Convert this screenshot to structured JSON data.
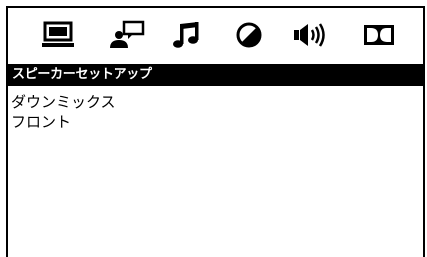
{
  "tabs": [
    {
      "icon": "monitor-icon",
      "selected": true
    },
    {
      "icon": "person-speech-icon",
      "selected": false
    },
    {
      "icon": "music-note-icon",
      "selected": false
    },
    {
      "icon": "contrast-circle-icon",
      "selected": false
    },
    {
      "icon": "speaker-volume-icon",
      "selected": false
    },
    {
      "icon": "dolby-icon",
      "selected": false
    }
  ],
  "header": {
    "title": "スピーカーセットアップ"
  },
  "menu": {
    "items": [
      {
        "label": "ダウンミックス"
      },
      {
        "label": "フロント"
      }
    ]
  },
  "colors": {
    "foreground": "#000000",
    "background": "#ffffff",
    "header_text": "#ffffff"
  }
}
